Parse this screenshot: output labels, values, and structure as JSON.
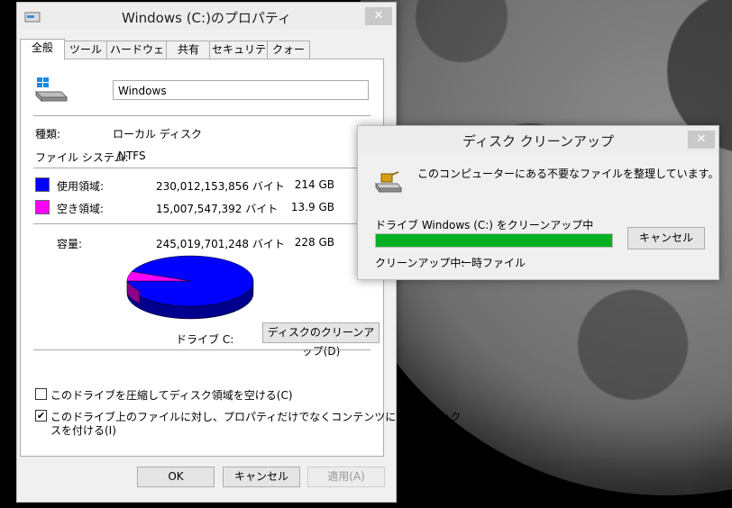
{
  "properties": {
    "title": "Windows (C:)のプロパティ",
    "close_label": "✕",
    "tabs": [
      {
        "label": "全般"
      },
      {
        "label": "ツール"
      },
      {
        "label": "ハードウェア"
      },
      {
        "label": "共有"
      },
      {
        "label": "セキュリティ"
      },
      {
        "label": "クォータ"
      }
    ],
    "drive_name": "Windows",
    "type_label": "種類:",
    "type_value": "ローカル ディスク",
    "fs_label": "ファイル システム:",
    "fs_value": "NTFS",
    "used": {
      "label": "使用領域:",
      "bytes": "230,012,153,856 バイト",
      "size": "214 GB",
      "color": "#0000ff"
    },
    "free": {
      "label": "空き領域:",
      "bytes": "15,007,547,392 バイト",
      "size": "13.9 GB",
      "color": "#ff00ff"
    },
    "capacity": {
      "label": "容量:",
      "bytes": "245,019,701,248 バイト",
      "size": "228 GB"
    },
    "drive_label": "ドライブ C:",
    "cleanup_button": "ディスクのクリーンアップ(D)",
    "compress_label": "このドライブを圧縮してディスク領域を空ける(C)",
    "compress_checked": false,
    "index_label_line1": "このドライブ上のファイルに対し、プロパティだけでなくコンテンツにもインデック",
    "index_label_line2": "スを付ける(I)",
    "index_checked": true,
    "ok": "OK",
    "cancel": "キャンセル",
    "apply": "適用(A)"
  },
  "chart_data": {
    "type": "pie",
    "categories": [
      "使用領域",
      "空き領域"
    ],
    "values": [
      214,
      13.9
    ],
    "colors": [
      "#0000ff",
      "#ff00ff"
    ]
  },
  "cleanup": {
    "title": "ディスク クリーンアップ",
    "close_label": "✕",
    "message": "このコンピューターにある不要なファイルを整理しています。",
    "progress_label": "ドライブ Windows (C:) をクリーンアップ中",
    "progress": 1.0,
    "cancel": "キャンセル",
    "status_label": "クリーンアップ中:",
    "status_value": "一時ファイル"
  }
}
